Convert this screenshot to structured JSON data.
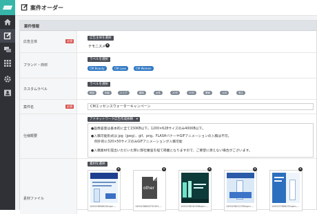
{
  "header": {
    "title": "案件オーダー"
  },
  "section": {
    "title": "案件情報"
  },
  "labels": {
    "advertiser": "広告主体",
    "brand": "ブランド・商材",
    "custom_label": "カスタムラベル",
    "campaign_name": "案件名",
    "spec": "仕様概要",
    "asset_files": "素材ファイル",
    "required": "必須"
  },
  "advertiser": {
    "button": "広告主体を選択",
    "value": "テモニスメ"
  },
  "brand": {
    "button": "ラベルを選択",
    "chips": [
      "CM Beauty",
      "CM Luxe",
      "CM Women"
    ]
  },
  "custom_label": {
    "button": "ラベルを選択",
    "chips": [
      "美容",
      "年齢",
      "エリア",
      "趣味",
      "女性",
      "20代",
      "30代",
      "関東",
      "九州",
      "夏広"
    ]
  },
  "campaign_name": {
    "value": "CMエッセンスウォーターキャンペーン"
  },
  "spec": {
    "button": "アドネットワーク広告作成依頼",
    "lines": [
      "●画像容量は基本的に全て150KB以下。1200×628サイズのみ400KB以下。",
      "●入稿可能形式は jpg（jpeg）、gif、png、FLASHバナーやGIFアニメーションの入稿は不可。",
      "例外的に320×50サイズのみGIFアニメーションが入稿可能",
      "●入稿素材を提出いただいた際に弊社審査を経て掲載となりますので、ご要望に添えない場合がございます。"
    ]
  },
  "assets": {
    "button": "素材を選択",
    "files": [
      {
        "caption": "1450238568181xpn-...",
        "kind": "image"
      },
      {
        "caption": "1450238826791391-...",
        "kind": "other",
        "badge": "other"
      },
      {
        "caption": "1450238240058xpm-...",
        "kind": "image"
      },
      {
        "caption": "1450238212390xpm-...",
        "kind": "image"
      },
      {
        "caption": "1450237888231xpm-...",
        "kind": "image"
      }
    ]
  }
}
